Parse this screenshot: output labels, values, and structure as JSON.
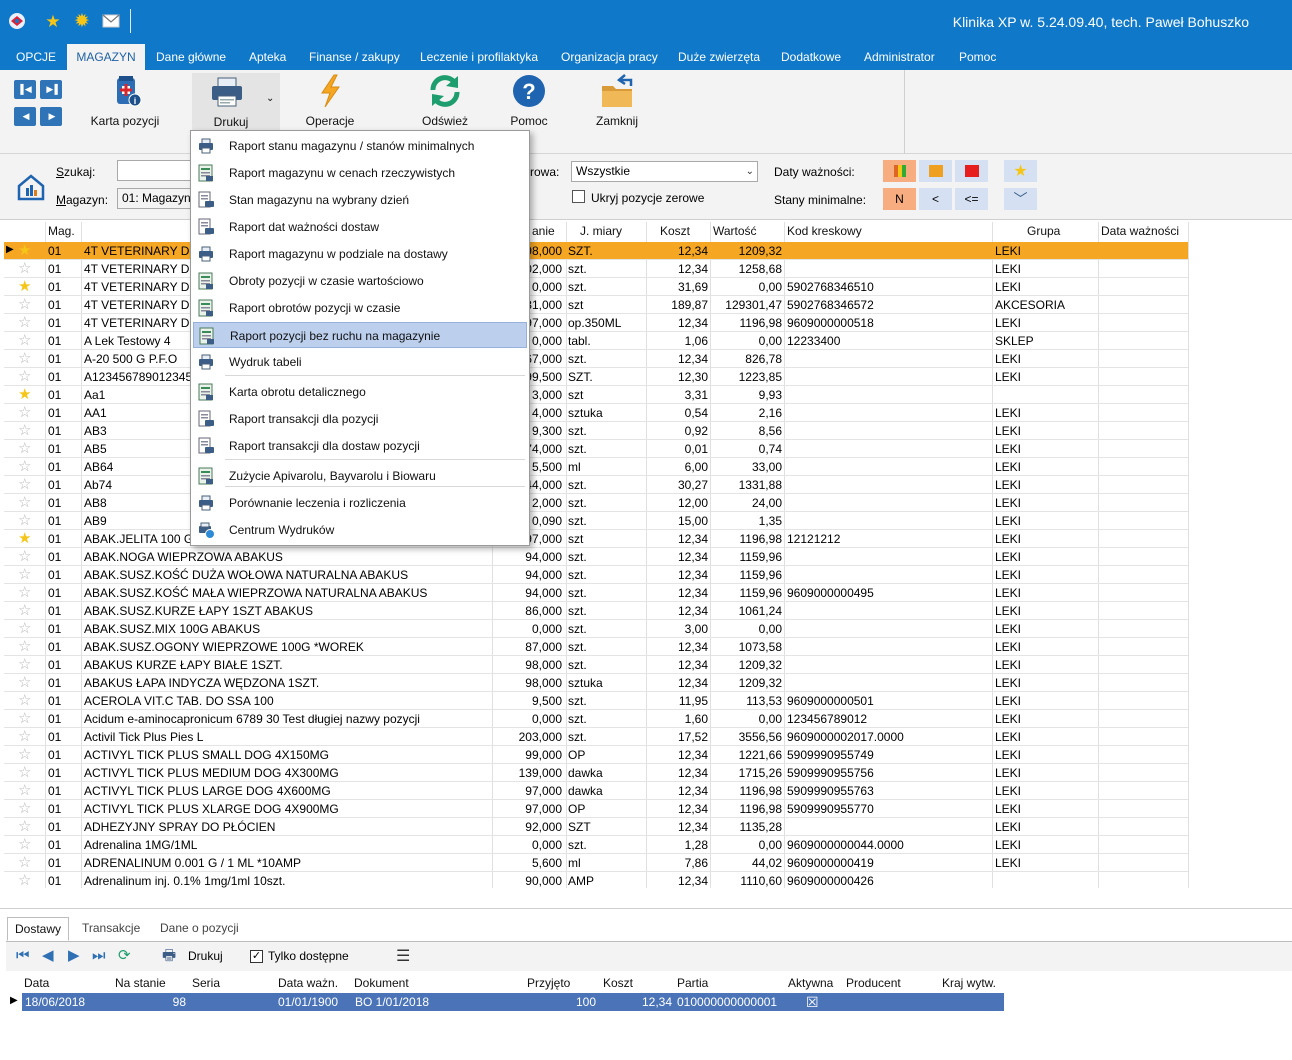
{
  "app_title": "Klinika XP w. 5.24.09.40, tech. Paweł Bohuszko",
  "quick_access": {
    "star_color": "#f5c518",
    "sun_color": "#f5c518"
  },
  "menu": [
    {
      "label": "OPCJE",
      "x_hint": "opcje"
    },
    {
      "label": "MAGAZYN"
    },
    {
      "label": "Dane główne"
    },
    {
      "label": "Apteka"
    },
    {
      "label": "Finanse / zakupy"
    },
    {
      "label": "Leczenie i profilaktyka"
    },
    {
      "label": "Organizacja pracy"
    },
    {
      "label": "Duże zwierzęta"
    },
    {
      "label": "Dodatkowe"
    },
    {
      "label": "Administrator"
    },
    {
      "label": "Pomoc"
    }
  ],
  "ribbon": {
    "karta": "Karta pozycji",
    "drukuj": "Drukuj",
    "operacje": "Operacje",
    "odswiez": "Odśwież",
    "pomoc": "Pomoc",
    "zamknij": "Zamknij"
  },
  "filters": {
    "szukaj_label": "Szukaj:",
    "szukaj_value": "",
    "magazyn_label": "Magazyn:",
    "magazyn_value": "01: Magazyn",
    "grupa_label_partial": "rowa:",
    "grupa_value": "Wszystkie",
    "ukryj_label": "Ukryj pozycje zerowe",
    "daty_label": "Daty ważności:",
    "stany_label": "Stany minimalne:",
    "chip_n": "N",
    "chip_lt": "<",
    "chip_le": "<="
  },
  "columns": {
    "mag": "Mag.",
    "stan": "anie",
    "jm": "J. miary",
    "koszt": "Koszt",
    "wartosc": "Wartość",
    "kod": "Kod kreskowy",
    "grupa": "Grupa",
    "data": "Data ważności"
  },
  "rows": [
    {
      "star": true,
      "mag": "01",
      "name": "4T VETERINARY DIE",
      "stan": "98,000",
      "jm": "SZT.",
      "koszt": "12,34",
      "wartosc": "1209,32",
      "kod": "",
      "grupa": "LEKI"
    },
    {
      "star": false,
      "mag": "01",
      "name": "4T VETERINARY DIE",
      "stan": "02,000",
      "jm": "szt.",
      "koszt": "12,34",
      "wartosc": "1258,68",
      "kod": "",
      "grupa": "LEKI"
    },
    {
      "star": true,
      "mag": "01",
      "name": "4T VETERINARY DIE",
      "stan": "0,000",
      "jm": "szt.",
      "koszt": "31,69",
      "wartosc": "0,00",
      "kod": "5902768346510",
      "grupa": "LEKI"
    },
    {
      "star": false,
      "mag": "01",
      "name": "4T VETERINARY DIE",
      "stan": "31,000",
      "jm": "szt",
      "koszt": "189,87",
      "wartosc": "129301,47",
      "kod": "5902768346572",
      "grupa": "AKCESORIA"
    },
    {
      "star": false,
      "mag": "01",
      "name": "4T VETERINARY DIE",
      "stan": "97,000",
      "jm": "op.350ML",
      "koszt": "12,34",
      "wartosc": "1196,98",
      "kod": "9609000000518",
      "grupa": "LEKI"
    },
    {
      "star": false,
      "mag": "01",
      "name": "A Lek Testowy 4",
      "stan": "0,000",
      "jm": "tabl.",
      "koszt": "1,06",
      "wartosc": "0,00",
      "kod": "12233400",
      "grupa": "SKLEP"
    },
    {
      "star": false,
      "mag": "01",
      "name": "A-20 500 G    P.F.O",
      "stan": "67,000",
      "jm": "szt.",
      "koszt": "12,34",
      "wartosc": "826,78",
      "kod": "",
      "grupa": "LEKI"
    },
    {
      "star": false,
      "mag": "01",
      "name": "A123456789012345",
      "stan": "99,500",
      "jm": "SZT.",
      "koszt": "12,30",
      "wartosc": "1223,85",
      "kod": "",
      "grupa": "LEKI"
    },
    {
      "star": true,
      "mag": "01",
      "name": "Aa1",
      "stan": "3,000",
      "jm": "szt",
      "koszt": "3,31",
      "wartosc": "9,93",
      "kod": "",
      "grupa": ""
    },
    {
      "star": false,
      "mag": "01",
      "name": "AA1",
      "stan": "4,000",
      "jm": "sztuka",
      "koszt": "0,54",
      "wartosc": "2,16",
      "kod": "",
      "grupa": "LEKI"
    },
    {
      "star": false,
      "mag": "01",
      "name": "AB3",
      "stan": "9,300",
      "jm": "szt.",
      "koszt": "0,92",
      "wartosc": "8,56",
      "kod": "",
      "grupa": "LEKI"
    },
    {
      "star": false,
      "mag": "01",
      "name": "AB5",
      "stan": "74,000",
      "jm": "szt.",
      "koszt": "0,01",
      "wartosc": "0,74",
      "kod": "",
      "grupa": "LEKI"
    },
    {
      "star": false,
      "mag": "01",
      "name": "AB64",
      "stan": "5,500",
      "jm": "ml",
      "koszt": "6,00",
      "wartosc": "33,00",
      "kod": "",
      "grupa": "LEKI"
    },
    {
      "star": false,
      "mag": "01",
      "name": "Ab74",
      "stan": "44,000",
      "jm": "szt.",
      "koszt": "30,27",
      "wartosc": "1331,88",
      "kod": "",
      "grupa": "LEKI"
    },
    {
      "star": false,
      "mag": "01",
      "name": "AB8",
      "stan": "2,000",
      "jm": "szt.",
      "koszt": "12,00",
      "wartosc": "24,00",
      "kod": "",
      "grupa": "LEKI"
    },
    {
      "star": false,
      "mag": "01",
      "name": "AB9",
      "stan": "0,090",
      "jm": "szt.",
      "koszt": "15,00",
      "wartosc": "1,35",
      "kod": "",
      "grupa": "LEKI"
    },
    {
      "star": true,
      "mag": "01",
      "name": "ABAK.JELITA 100 G",
      "stan": "97,000",
      "jm": "szt",
      "koszt": "12,34",
      "wartosc": "1196,98",
      "kod": "12121212",
      "grupa": "LEKI"
    },
    {
      "star": false,
      "mag": "01",
      "name": "ABAK.NOGA WIEPRZOWA    ABAKUS",
      "stan": "94,000",
      "jm": "szt.",
      "koszt": "12,34",
      "wartosc": "1159,96",
      "kod": "",
      "grupa": "LEKI"
    },
    {
      "star": false,
      "mag": "01",
      "name": "ABAK.SUSZ.KOŚĆ DUŻA WOŁOWA NATURALNA      ABAKUS",
      "stan": "94,000",
      "jm": "szt.",
      "koszt": "12,34",
      "wartosc": "1159,96",
      "kod": "",
      "grupa": "LEKI"
    },
    {
      "star": false,
      "mag": "01",
      "name": "ABAK.SUSZ.KOŚĆ MAŁA WIEPRZOWA NATURALNA      ABAKUS",
      "stan": "94,000",
      "jm": "szt.",
      "koszt": "12,34",
      "wartosc": "1159,96",
      "kod": "9609000000495",
      "grupa": "LEKI"
    },
    {
      "star": false,
      "mag": "01",
      "name": "ABAK.SUSZ.KURZE ŁAPY 1SZT      ABAKUS",
      "stan": "86,000",
      "jm": "szt.",
      "koszt": "12,34",
      "wartosc": "1061,24",
      "kod": "",
      "grupa": "LEKI"
    },
    {
      "star": false,
      "mag": "01",
      "name": "ABAK.SUSZ.MIX 100G ABAKUS",
      "stan": "0,000",
      "jm": "szt.",
      "koszt": "3,00",
      "wartosc": "0,00",
      "kod": "",
      "grupa": "LEKI"
    },
    {
      "star": false,
      "mag": "01",
      "name": "ABAK.SUSZ.OGONY WIEPRZOWE 100G *WOREK",
      "stan": "87,000",
      "jm": "szt.",
      "koszt": "12,34",
      "wartosc": "1073,58",
      "kod": "",
      "grupa": "LEKI"
    },
    {
      "star": false,
      "mag": "01",
      "name": "ABAKUS KURZE ŁAPY BIAŁE 1SZT.",
      "stan": "98,000",
      "jm": "szt.",
      "koszt": "12,34",
      "wartosc": "1209,32",
      "kod": "",
      "grupa": "LEKI"
    },
    {
      "star": false,
      "mag": "01",
      "name": "ABAKUS ŁAPA INDYCZA WĘDZONA 1SZT.",
      "stan": "98,000",
      "jm": "sztuka",
      "koszt": "12,34",
      "wartosc": "1209,32",
      "kod": "",
      "grupa": "LEKI"
    },
    {
      "star": false,
      "mag": "01",
      "name": "ACEROLA VIT.C TAB. DO SSA 100",
      "stan": "9,500",
      "jm": "szt.",
      "koszt": "11,95",
      "wartosc": "113,53",
      "kod": "9609000000501",
      "grupa": "LEKI"
    },
    {
      "star": false,
      "mag": "01",
      "name": "Acidum e-aminocapronicum 6789 30 Test długiej nazwy pozycji",
      "stan": "0,000",
      "jm": "szt.",
      "koszt": "1,60",
      "wartosc": "0,00",
      "kod": "123456789012",
      "grupa": "LEKI"
    },
    {
      "star": false,
      "mag": "01",
      "name": "Activil Tick Plus Pies L",
      "stan": "203,000",
      "jm": "szt.",
      "koszt": "17,52",
      "wartosc": "3556,56",
      "kod": "9609000002017.0000",
      "grupa": "LEKI"
    },
    {
      "star": false,
      "mag": "01",
      "name": "ACTIVYL TICK PLUS   SMALL DOG 4X150MG",
      "stan": "99,000",
      "jm": "OP",
      "koszt": "12,34",
      "wartosc": "1221,66",
      "kod": "5909990955749",
      "grupa": "LEKI"
    },
    {
      "star": false,
      "mag": "01",
      "name": "ACTIVYL TICK PLUS  MEDIUM DOG 4X300MG",
      "stan": "139,000",
      "jm": "dawka",
      "koszt": "12,34",
      "wartosc": "1715,26",
      "kod": "5909990955756",
      "grupa": "LEKI"
    },
    {
      "star": false,
      "mag": "01",
      "name": "ACTIVYL TICK PLUS LARGE DOG 4X600MG",
      "stan": "97,000",
      "jm": "dawka",
      "koszt": "12,34",
      "wartosc": "1196,98",
      "kod": "5909990955763",
      "grupa": "LEKI"
    },
    {
      "star": false,
      "mag": "01",
      "name": "ACTIVYL TICK PLUS XLARGE DOG 4X900MG",
      "stan": "97,000",
      "jm": "OP",
      "koszt": "12,34",
      "wartosc": "1196,98",
      "kod": "5909990955770",
      "grupa": "LEKI"
    },
    {
      "star": false,
      "mag": "01",
      "name": "ADHEZYJNY SPRAY DO PŁÓCIEN",
      "stan": "92,000",
      "jm": "SZT",
      "koszt": "12,34",
      "wartosc": "1135,28",
      "kod": "",
      "grupa": "LEKI"
    },
    {
      "star": false,
      "mag": "01",
      "name": "Adrenalina 1MG/1ML",
      "stan": "0,000",
      "jm": "szt.",
      "koszt": "1,28",
      "wartosc": "0,00",
      "kod": "9609000000044.0000",
      "grupa": "LEKI"
    },
    {
      "star": false,
      "mag": "01",
      "name": "ADRENALINUM 0.001 G / 1 ML *10AMP",
      "stan": "5,600",
      "jm": "ml",
      "koszt": "7,86",
      "wartosc": "44,02",
      "kod": "9609000000419",
      "grupa": "LEKI"
    },
    {
      "star": false,
      "mag": "01",
      "name": "Adrenalinum inj. 0.1% 1mg/1ml 10szt.",
      "stan": "90,000",
      "jm": "AMP",
      "koszt": "12,34",
      "wartosc": "1110,60",
      "kod": "9609000000426",
      "grupa": ""
    }
  ],
  "dropdown": [
    {
      "label": "Raport stanu magazynu / stanów minimalnych",
      "icon": "printer-icon"
    },
    {
      "label": "Raport magazynu w cenach rzeczywistych",
      "icon": "report-icon"
    },
    {
      "label": "Stan magazynu na wybrany dzień",
      "icon": "document-printer-icon"
    },
    {
      "label": "Raport dat ważności dostaw",
      "icon": "document-printer-icon"
    },
    {
      "label": "Raport magazynu w podziale na dostawy",
      "icon": "printer-icon"
    },
    {
      "label": "Obroty pozycji w czasie wartościowo",
      "icon": "report-icon"
    },
    {
      "label": "Raport obrotów pozycji w czasie",
      "icon": "report-icon"
    },
    {
      "label": "Raport pozycji bez ruchu na magazynie",
      "icon": "report-icon"
    },
    {
      "label": "Wydruk tabeli",
      "icon": "printer-icon"
    },
    {
      "label": "Karta obrotu detalicznego",
      "icon": "report-icon"
    },
    {
      "label": "Raport transakcji dla pozycji",
      "icon": "document-printer-icon"
    },
    {
      "label": "Raport transakcji dla dostaw pozycji",
      "icon": "document-printer-icon"
    },
    {
      "label": "Zużycie Apivarolu, Bayvarolu i Biowaru",
      "icon": "report-icon"
    },
    {
      "label": "Porównanie leczenia i rozliczenia",
      "icon": "printer-icon"
    },
    {
      "label": "Centrum Wydruków",
      "icon": "printer-globe-icon"
    }
  ],
  "bottom": {
    "tabs": [
      "Dostawy",
      "Transakcje",
      "Dane o pozycji"
    ],
    "drukuj": "Drukuj",
    "tylko": "Tylko dostępne",
    "headers": {
      "data": "Data",
      "na_stanie": "Na stanie",
      "seria": "Seria",
      "data_wazn": "Data ważn.",
      "dokument": "Dokument",
      "przyjeto": "Przyjęto",
      "koszt": "Koszt",
      "partia": "Partia",
      "aktywna": "Aktywna",
      "producent": "Producent",
      "kraj": "Kraj wytw."
    },
    "row": {
      "data": "18/06/2018",
      "na_stanie": "98",
      "seria": "",
      "data_wazn": "01/01/1900",
      "dokument": "BO 1/01/2018",
      "przyjeto": "100",
      "koszt": "12,34",
      "partia": "010000000000001",
      "aktywna": "☒"
    }
  },
  "colors": {
    "accent": "#0f78c8",
    "selected_row": "#f5a623",
    "highlight_item": "#bcd0ee",
    "bottom_selected": "#4b74b8"
  }
}
